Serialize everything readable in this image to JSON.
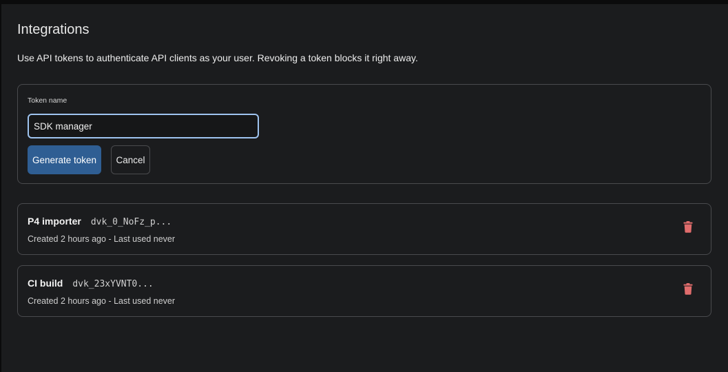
{
  "page": {
    "title": "Integrations",
    "description": "Use API tokens to authenticate API clients as your user. Revoking a token blocks it right away."
  },
  "create_form": {
    "label": "Token name",
    "input_value": "SDK manager",
    "generate_label": "Generate token",
    "cancel_label": "Cancel"
  },
  "tokens": [
    {
      "name": "P4 importer",
      "prefix": "dvk_0_NoFz_p...",
      "meta": "Created 2 hours ago - Last used never"
    },
    {
      "name": "CI build",
      "prefix": "dvk_23xYVNT0...",
      "meta": "Created 2 hours ago - Last used never"
    }
  ],
  "icons": {
    "delete": "trash-icon"
  },
  "colors": {
    "background": "#1b1c1e",
    "primary_button": "#2f5e93",
    "input_focus": "#9fc4f0",
    "danger": "#e06c6c",
    "border": "#4a4b4e"
  }
}
